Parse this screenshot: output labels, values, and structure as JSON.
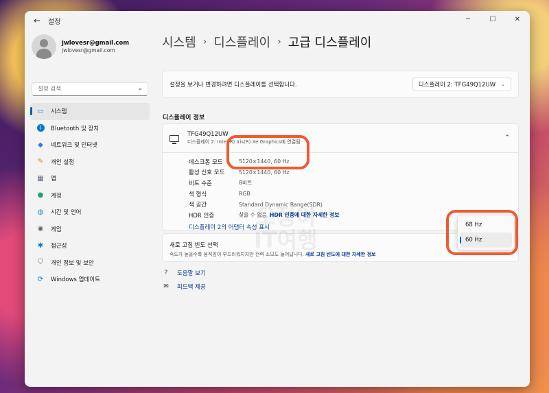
{
  "window": {
    "title": "설정"
  },
  "profile": {
    "name": "jwlovesr@gmail.com",
    "email": "jwlovesr@gmail.com"
  },
  "search": {
    "placeholder": "설정 검색"
  },
  "sidebar": {
    "items": [
      {
        "label": "시스템",
        "icon": "monitor-icon",
        "active": true
      },
      {
        "label": "Bluetooth 및 장치",
        "icon": "bluetooth-icon"
      },
      {
        "label": "네트워크 및 인터넷",
        "icon": "wifi-icon"
      },
      {
        "label": "개인 설정",
        "icon": "brush-icon"
      },
      {
        "label": "앱",
        "icon": "apps-icon"
      },
      {
        "label": "계정",
        "icon": "person-icon"
      },
      {
        "label": "시간 및 언어",
        "icon": "globe-icon"
      },
      {
        "label": "게임",
        "icon": "gamepad-icon"
      },
      {
        "label": "접근성",
        "icon": "accessibility-icon"
      },
      {
        "label": "개인 정보 및 보안",
        "icon": "shield-icon"
      },
      {
        "label": "Windows 업데이트",
        "icon": "update-icon"
      }
    ]
  },
  "breadcrumb": {
    "item1": "시스템",
    "item2": "디스플레이",
    "item3": "고급 디스플레이"
  },
  "display_select": {
    "label": "설정을 보거나 변경하려면 디스플레이를 선택합니다.",
    "selected": "디스플레이 2: TFG49Q12UW"
  },
  "section_title": "디스플레이 정보",
  "display_info": {
    "name": "TFG49Q12UW",
    "subtitle": "디스플레이 2: Intel(R) Iris(R) Xe Graphics에 연결됨",
    "rows": [
      {
        "key": "데스크톱 모드",
        "value": "5120×1440, 60 Hz"
      },
      {
        "key": "활성 신호 모드",
        "value": "5120×1440, 60 Hz"
      },
      {
        "key": "비트 수준",
        "value": "8비트"
      },
      {
        "key": "색 형식",
        "value": "RGB"
      },
      {
        "key": "색 공간",
        "value": "Standard Dynamic Range(SDR)"
      },
      {
        "key": "HDR 인증",
        "value": "찾을 수 없음",
        "link": "HDR 인증에 대한 자세한 정보"
      }
    ],
    "adapter_link": "디스플레이 2의 어댑터 속성 표시"
  },
  "refresh": {
    "title": "새로 고침 빈도 선택",
    "description": "속도가 높을수록 움직임이 부드러워지지만 전력 소모도 늘어납니다.",
    "link": "새로 고침 빈도에 대한 자세한 정보"
  },
  "refresh_popup": {
    "options": [
      "68 Hz",
      "60 Hz"
    ],
    "selected": "60 Hz"
  },
  "help": {
    "help_label": "도움말 보기",
    "feedback_label": "피드백 제공"
  },
  "watermark": {
    "line1": "오정이",
    "line2": "IT여행"
  },
  "colors": {
    "accent": "#005fb8",
    "link": "#003e92",
    "highlight": "#f05a30"
  }
}
